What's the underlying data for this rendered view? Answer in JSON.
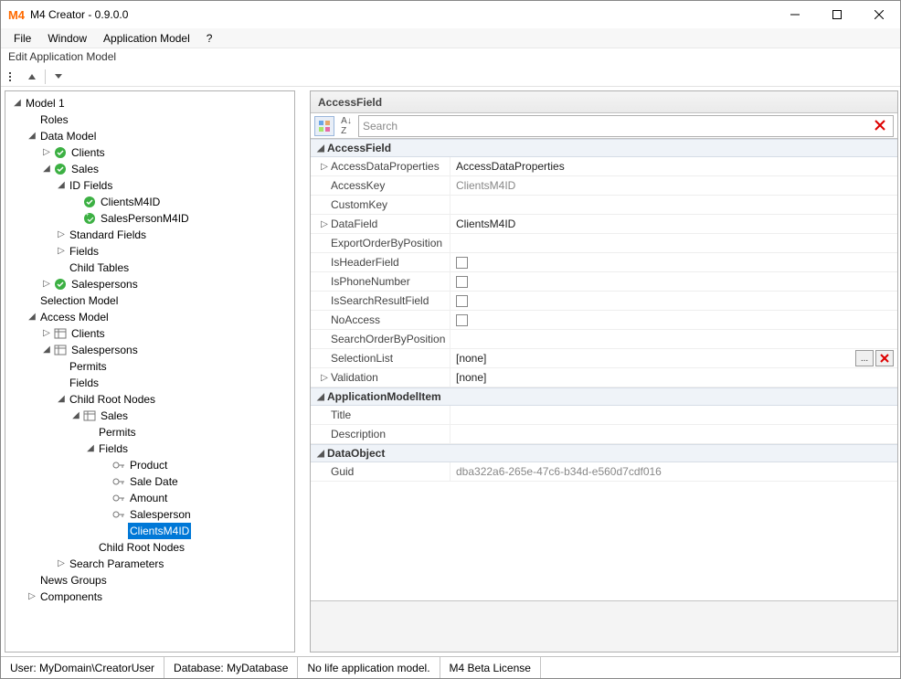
{
  "window": {
    "title": "M4 Creator - 0.9.0.0",
    "app_icon": "M4"
  },
  "menu": {
    "file": "File",
    "window": "Window",
    "app_model": "Application Model",
    "help": "?"
  },
  "doc_tab": "Edit Application Model",
  "tree": {
    "model1": "Model 1",
    "roles": "Roles",
    "data_model": "Data Model",
    "clients": "Clients",
    "sales": "Sales",
    "id_fields": "ID Fields",
    "clients_m4id": "ClientsM4ID",
    "salesperson_m4id": "SalesPersonM4ID",
    "standard_fields": "Standard Fields",
    "fields": "Fields",
    "child_tables": "Child Tables",
    "salespersons": "Salespersons",
    "selection_model": "Selection Model",
    "access_model": "Access Model",
    "access_clients": "Clients",
    "access_salespersons": "Salespersons",
    "permits": "Permits",
    "fields2": "Fields",
    "child_root_nodes": "Child Root Nodes",
    "sales2": "Sales",
    "permits2": "Permits",
    "fields3": "Fields",
    "product": "Product",
    "sale_date": "Sale Date",
    "amount": "Amount",
    "salesperson": "Salesperson",
    "clients_m4id_sel": "ClientsM4ID",
    "child_root_nodes2": "Child Root Nodes",
    "search_params": "Search Parameters",
    "news_groups": "News Groups",
    "components": "Components"
  },
  "propgrid": {
    "header": "AccessField",
    "search_placeholder": "Search",
    "cats": {
      "access_field": "AccessField",
      "app_model_item": "ApplicationModelItem",
      "data_object": "DataObject"
    },
    "rows": {
      "access_data_props": "AccessDataProperties",
      "access_data_props_val": "AccessDataProperties",
      "access_key": "AccessKey",
      "access_key_val": "ClientsM4ID",
      "custom_key": "CustomKey",
      "data_field": "DataField",
      "data_field_val": "ClientsM4ID",
      "export_order": "ExportOrderByPosition",
      "is_header": "IsHeaderField",
      "is_phone": "IsPhoneNumber",
      "is_search": "IsSearchResultField",
      "no_access": "NoAccess",
      "search_order": "SearchOrderByPosition",
      "selection_list": "SelectionList",
      "selection_list_val": "[none]",
      "validation": "Validation",
      "validation_val": "[none]",
      "title": "Title",
      "description": "Description",
      "guid": "Guid",
      "guid_val": "dba322a6-265e-47c6-b34d-e560d7cdf016",
      "ellipsis": "..."
    }
  },
  "status": {
    "user": "User: MyDomain\\CreatorUser",
    "database": "Database: MyDatabase",
    "life": "No life application model.",
    "license": "M4 Beta License"
  }
}
